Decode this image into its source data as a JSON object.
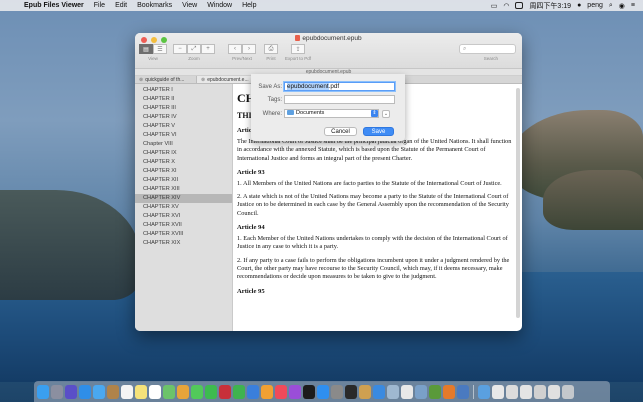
{
  "menubar": {
    "app_name": "Epub Files Viewer",
    "menus": [
      "File",
      "Edit",
      "Bookmarks",
      "View",
      "Window",
      "Help"
    ],
    "clock": "周四下午3:19",
    "user": "peng"
  },
  "window": {
    "title": "epubdocument.epub",
    "doc_title": "epubdocument.epub",
    "toolbar": {
      "view_label": "View",
      "zoom_label": "Zoom",
      "prevnext_label": "Prev/Next",
      "print_label": "Print",
      "export_label": "Export to Pdf",
      "search_label": "Search"
    },
    "tabs": [
      {
        "label": "quickguide of th..."
      },
      {
        "label": "epubdocument.e..."
      }
    ]
  },
  "sidebar": {
    "chapters": [
      "CHAPTER I",
      "CHAPTER II",
      "CHAPTER III",
      "CHAPTER IV",
      "CHAPTER V",
      "CHAPTER VI",
      "Chapter VIII",
      "CHAPTER IX",
      "CHAPTER X",
      "CHAPTER XI",
      "CHAPTER XII",
      "CHAPTER XIII",
      "CHAPTER XIV",
      "CHAPTER XV",
      "CHAPTER XVI",
      "CHAPTER XVII",
      "CHAPTER XVIII",
      "CHAPTER XIX"
    ],
    "selected": "CHAPTER XIV"
  },
  "reader": {
    "heading": "CH",
    "subheading": "THI",
    "article_partial": "Artic",
    "p1": "The International Court of Justice shall be the principal judicial organ of the United Nations. It shall function in accordance with the annexed Statute, which is based upon the Statute of the Permanent Court of International Justice and forms an integral part of the present Charter.",
    "article93": "Article 93",
    "p2": "1. All Members of the United Nations are facto parties to the Statute of the International Court of Justice.",
    "p3": "2. A state which is not of the United Nations may become a party to the Statute of the International Court of Justice on to be determined in each case by the General Assembly upon the recommendation of the Security Council.",
    "article94": "Article 94",
    "p4": "1. Each Member of the United Nations undertakes to comply with the decision of the International Court of Justice in any case to which it is a party.",
    "p5": "2. If any party to a case fails to perform the obligations incumbent upon it under a judgment rendered by the Court, the other party may have recourse to the Security Council, which may, if it deems necessary, make recommendations or decide upon measures to be taken to give to the judgment.",
    "article95": "Article 95"
  },
  "save_dialog": {
    "save_as_label": "Save As:",
    "filename_selected": "epubdocument",
    "filename_ext": ".pdf",
    "tags_label": "Tags:",
    "where_label": "Where:",
    "where_value": "Documents",
    "cancel_label": "Cancel",
    "save_label": "Save"
  },
  "colors": {
    "accent": "#3f8cf5",
    "sidebar_selected": "#b7b7b7"
  }
}
